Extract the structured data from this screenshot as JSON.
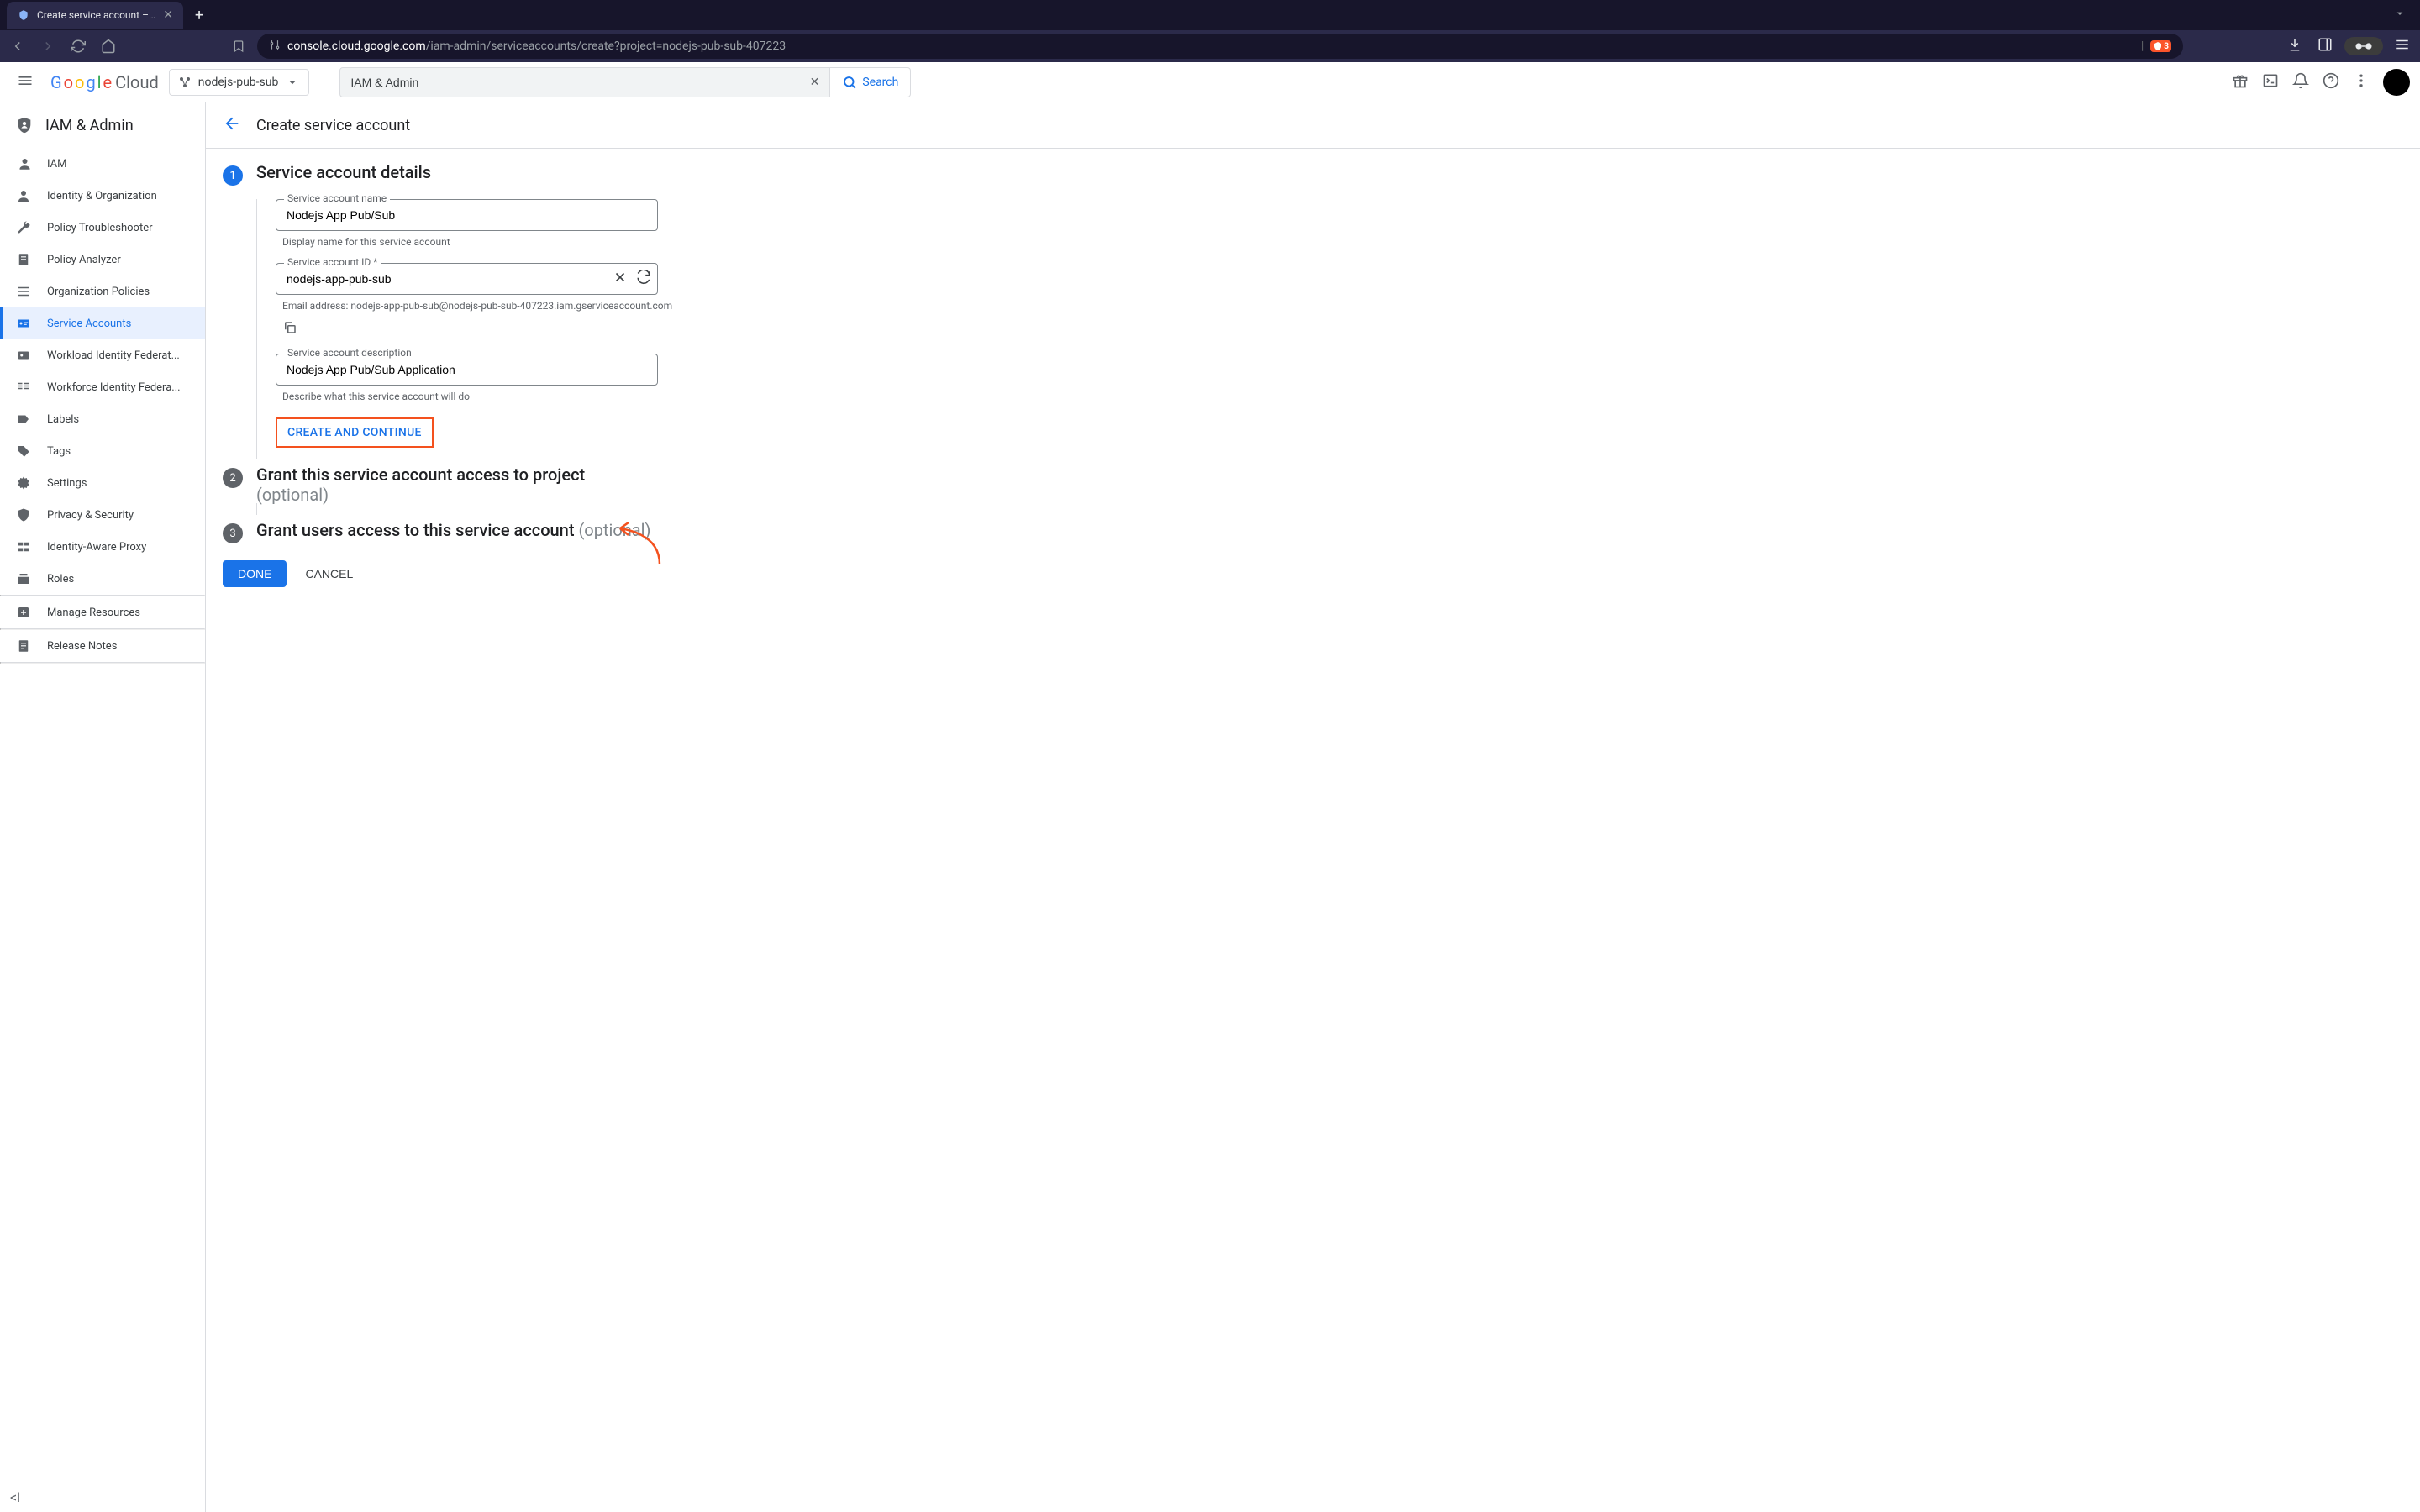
{
  "browser": {
    "tab_title": "Create service account – IAM &",
    "url_domain": "console.cloud.google.com",
    "url_path": "/iam-admin/serviceaccounts/create?project=nodejs-pub-sub-407223",
    "shield_count": "3"
  },
  "gcp": {
    "logo_cloud": "Cloud",
    "project_name": "nodejs-pub-sub",
    "search_value": "IAM & Admin",
    "search_btn": "Search"
  },
  "sidebar": {
    "header": "IAM & Admin",
    "items": [
      {
        "label": "IAM"
      },
      {
        "label": "Identity & Organization"
      },
      {
        "label": "Policy Troubleshooter"
      },
      {
        "label": "Policy Analyzer"
      },
      {
        "label": "Organization Policies"
      },
      {
        "label": "Service Accounts"
      },
      {
        "label": "Workload Identity Federat..."
      },
      {
        "label": "Workforce Identity Federa..."
      },
      {
        "label": "Labels"
      },
      {
        "label": "Tags"
      },
      {
        "label": "Settings"
      },
      {
        "label": "Privacy & Security"
      },
      {
        "label": "Identity-Aware Proxy"
      },
      {
        "label": "Roles"
      }
    ],
    "footer": [
      {
        "label": "Manage Resources"
      },
      {
        "label": "Release Notes"
      }
    ]
  },
  "page": {
    "title": "Create service account",
    "step1": {
      "num": "1",
      "title": "Service account details",
      "name_label": "Service account name",
      "name_value": "Nodejs App Pub/Sub",
      "name_helper": "Display name for this service account",
      "id_label": "Service account ID *",
      "id_value": "nodejs-app-pub-sub",
      "email_helper": "Email address: nodejs-app-pub-sub@nodejs-pub-sub-407223.iam.gserviceaccount.com",
      "desc_label": "Service account description",
      "desc_value": "Nodejs App Pub/Sub Application",
      "desc_helper": "Describe what this service account will do",
      "create_btn": "CREATE AND CONTINUE"
    },
    "step2": {
      "num": "2",
      "title": "Grant this service account access to project",
      "optional": "(optional)"
    },
    "step3": {
      "num": "3",
      "title": "Grant users access to this service account ",
      "optional": "(optional)"
    },
    "done": "DONE",
    "cancel": "CANCEL"
  }
}
